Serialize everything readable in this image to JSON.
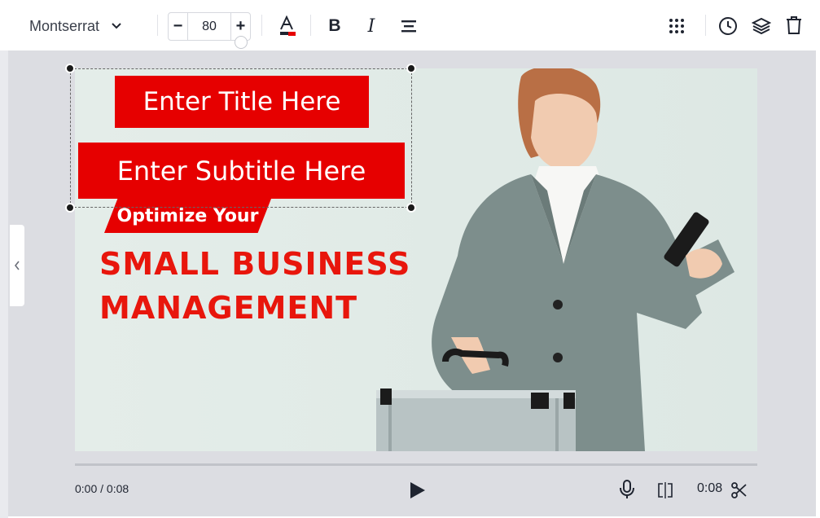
{
  "toolbar": {
    "font_name": "Montserrat",
    "font_size_value": "80",
    "decrement_label": "−",
    "increment_label": "+",
    "bold_label": "B",
    "italic_label": "I"
  },
  "slide": {
    "title_text": "Enter Title Here",
    "subtitle_text": "Enter Subtitle Here",
    "tag_text": "Optimize Your",
    "headline_line1": "SMALL BUSINESS",
    "headline_line2": "MANAGEMENT"
  },
  "playback": {
    "current_time": "0:00 / 0:08",
    "duration": "0:08"
  },
  "colors": {
    "accent_red": "#e60000",
    "headline_red": "#e8160c",
    "stage_gray": "#dcdde2",
    "slide_bg": "#e3ece8"
  },
  "icons": [
    "chevron-down-icon",
    "text-color-icon",
    "bold-icon",
    "italic-icon",
    "align-center-icon",
    "grid-dots-icon",
    "clock-icon",
    "layers-icon",
    "trash-icon",
    "chevron-left-icon",
    "play-icon",
    "microphone-icon",
    "split-icon",
    "scissors-icon"
  ]
}
